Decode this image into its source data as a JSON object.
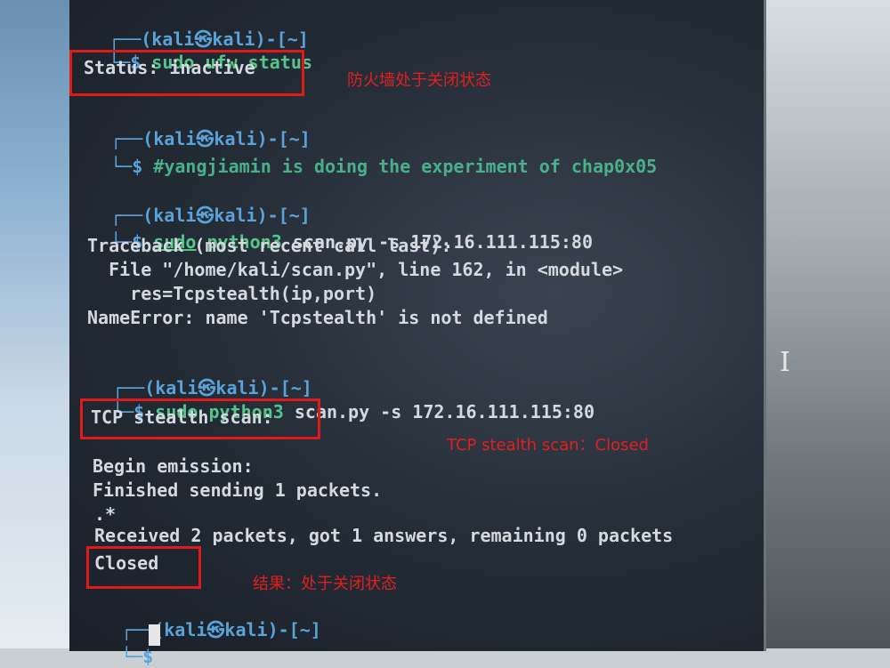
{
  "prompt": {
    "user": "(kali㉿kali)-[~]",
    "symbol": "$"
  },
  "blocks": [
    {
      "command": "sudo ufw status",
      "output": [
        "Status: inactive"
      ]
    },
    {
      "command": "#yangjiamin is doing the experiment of chap0x05",
      "output": []
    },
    {
      "command_sudo": "sudo",
      "command_mid": " python3 ",
      "command_file": "scan.py",
      "command_args": " -s 172.16.111.115:80",
      "output": [
        "Traceback (most recent call last):",
        "  File \"/home/kali/scan.py\", line 162, in <module>",
        "    res=Tcpstealth(ip,port)",
        "NameError: name 'Tcpstealth' is not defined"
      ]
    },
    {
      "command_sudo": "sudo",
      "command_mid": " python3 ",
      "command_file": "scan.py",
      "command_args": " -s 172.16.111.115:80",
      "output": [
        "TCP stealth scan:",
        "",
        "Begin emission:",
        "Finished sending 1 packets.",
        ".*",
        "Received 2 packets, got 1 answers, remaining 0 packets",
        "Closed"
      ]
    }
  ],
  "annotations": {
    "firewall": "防火墙处于关闭状态",
    "scan": "TCP stealth scan：Closed",
    "result": "结果：处于关闭状态"
  }
}
